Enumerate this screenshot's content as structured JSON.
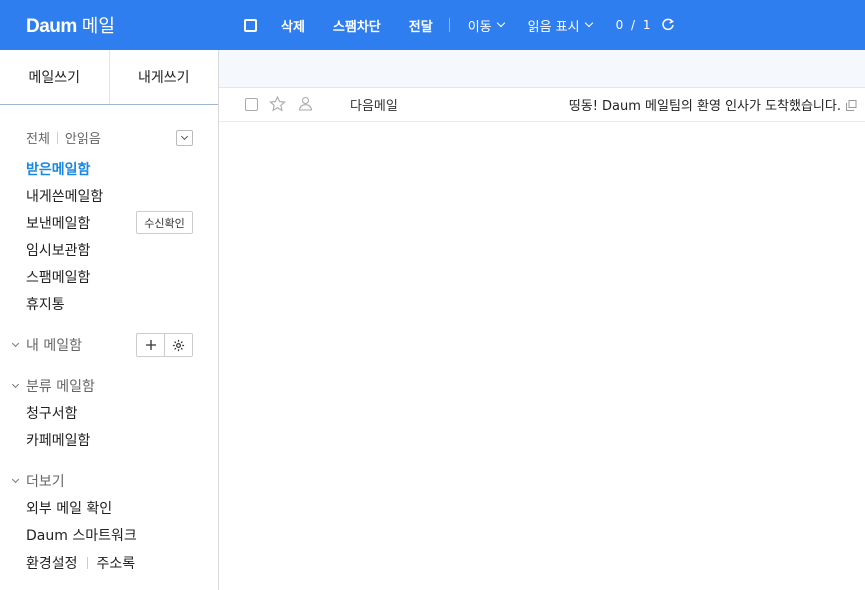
{
  "header": {
    "logo_brand": "Daum",
    "logo_service": "메일",
    "toolbar": {
      "delete": "삭제",
      "block_spam": "스팸차단",
      "forward": "전달",
      "move": "이동",
      "mark_read": "읽음 표시",
      "page_count": "0 / 1"
    },
    "colors": {
      "header_bg": "#2f7ef0",
      "active_mailbox": "#1a88e0"
    }
  },
  "sidebar": {
    "compose": "메일쓰기",
    "write_to_me": "내게쓰기",
    "filter_all": "전체",
    "filter_unread": "안읽음",
    "mailboxes": [
      "받은메일함",
      "내게쓴메일함",
      "보낸메일함",
      "임시보관함",
      "스팸메일함",
      "휴지통"
    ],
    "receipt_check": "수신확인",
    "my_mailbox": "내 메일함",
    "categorized": "분류 메일함",
    "category_items": [
      "청구서함",
      "카페메일함"
    ],
    "more": "더보기",
    "more_items": [
      "외부 메일 확인",
      "Daum 스마트워크"
    ],
    "settings": "환경설정",
    "address_book": "주소록"
  },
  "mail_list": [
    {
      "sender": "다음메일",
      "subject": "띵동! Daum 메일팀의 환영 인사가 도착했습니다."
    }
  ],
  "icons": [
    "checkbox-icon",
    "star-icon",
    "person-icon",
    "copy-icon",
    "refresh-icon",
    "plus-icon",
    "gear-icon",
    "chevron-down-icon"
  ]
}
